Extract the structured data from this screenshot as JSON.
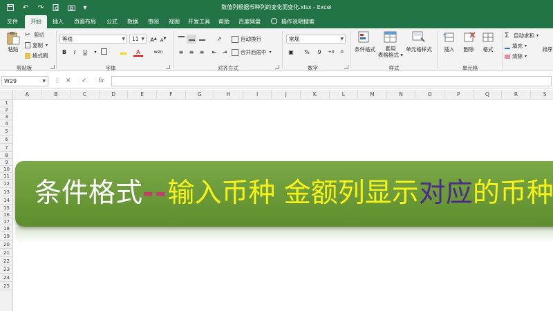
{
  "title_bar": {
    "doc_title": "数值列根据币种列的变化而变化.xlsx  -  Excel"
  },
  "menu": {
    "tabs": [
      "文件",
      "开始",
      "插入",
      "页面布局",
      "公式",
      "数据",
      "审阅",
      "视图",
      "开发工具",
      "帮助",
      "百度网盘"
    ],
    "active_tab": "开始",
    "tell_me": "操作说明搜索"
  },
  "ribbon": {
    "clipboard": {
      "paste": "粘贴",
      "cut": "剪切",
      "copy": "复制",
      "format_painter": "格式刷",
      "label": "剪贴板"
    },
    "font": {
      "font_name": "等线",
      "font_size": "11",
      "bold": "B",
      "italic": "I",
      "underline": "U",
      "grow": "A",
      "shrink": "A",
      "wen": "wén",
      "label": "字体"
    },
    "alignment": {
      "wrap_text": "自动换行",
      "merge_center": "合并后居中",
      "label": "对齐方式"
    },
    "number": {
      "format": "常规",
      "percent": "%",
      "comma": "9",
      "label": "数字"
    },
    "styles": {
      "conditional": "条件格式",
      "table_format": "套用\n表格格式",
      "cell_styles": "单元格样式",
      "label": "样式"
    },
    "cells": {
      "insert": "插入",
      "delete": "删除",
      "format": "格式",
      "label": "单元格"
    },
    "editing": {
      "autosum": "自动求和",
      "fill": "填充",
      "clear": "清除",
      "sort_filter": "排序"
    }
  },
  "formula_bar": {
    "name_box": "W29",
    "cancel": "✕",
    "enter": "✓",
    "fx": "fx",
    "value": ""
  },
  "grid": {
    "columns": [
      "A",
      "B",
      "C",
      "D",
      "E",
      "F",
      "G",
      "H",
      "I",
      "J",
      "K",
      "L",
      "M",
      "N",
      "O",
      "P",
      "Q",
      "R",
      "S"
    ],
    "rows": [
      "1",
      "2",
      "3",
      "4",
      "5",
      "6",
      "7",
      "8",
      "9",
      "10",
      "11",
      "12",
      "13",
      "14",
      "15",
      "16",
      "17",
      "18",
      "19",
      "20",
      "21",
      "22",
      "23",
      "24",
      "25"
    ]
  },
  "banner": {
    "part1": "条件格式",
    "dash": "--",
    "part2": "输入币种 金额列显示",
    "part3": "对应",
    "part4": "的币种符号"
  },
  "colors": {
    "excel_green": "#217346",
    "banner_green": "#6e9c3a",
    "banner_yellow": "#f7f21a",
    "banner_purple": "#4b2a8a",
    "banner_pink": "#c53d6e"
  }
}
